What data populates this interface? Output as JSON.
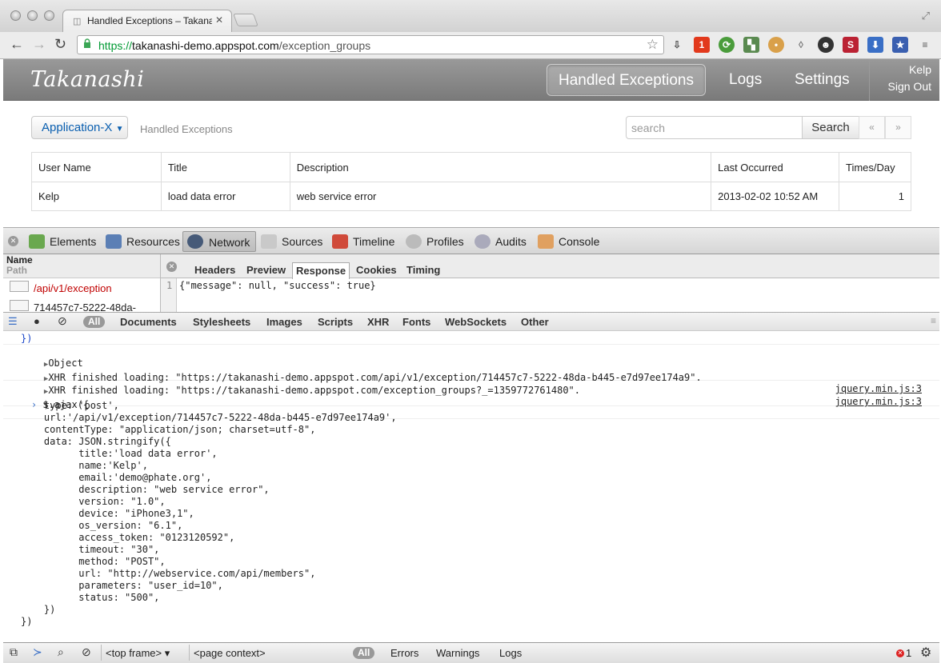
{
  "browser": {
    "tab_title": "Handled Exceptions – Takanashi",
    "url_protocol": "https://",
    "url_host": "takanashi-demo.appspot.com",
    "url_path": "/exception_groups",
    "extension_badge": "1"
  },
  "navbar": {
    "brand": "Takanashi",
    "items": [
      "Handled Exceptions",
      "Logs",
      "Settings"
    ],
    "user_name": "Kelp",
    "sign_out": "Sign Out"
  },
  "content": {
    "app_selector": "Application-X",
    "breadcrumb": "Handled Exceptions",
    "search_placeholder": "search",
    "search_button": "Search",
    "prev_page": "«",
    "next_page": "»",
    "table": {
      "headers": [
        "User Name",
        "Title",
        "Description",
        "Last Occurred",
        "Times/Day"
      ],
      "rows": [
        [
          "Kelp",
          "load data error",
          "web service error",
          "2013-02-02 10:52 AM",
          "1"
        ]
      ]
    }
  },
  "devtools": {
    "tabs": [
      "Elements",
      "Resources",
      "Network",
      "Sources",
      "Timeline",
      "Profiles",
      "Audits",
      "Console"
    ],
    "active_tab": "Network",
    "network": {
      "col_name": "Name",
      "col_path": "Path",
      "requests": [
        "/api/v1/exception",
        "714457c7-5222-48da-"
      ],
      "detail_tabs": [
        "Headers",
        "Preview",
        "Response",
        "Cookies",
        "Timing"
      ],
      "active_detail_tab": "Response",
      "response_line_no": "1",
      "response_body": "{\"message\": null, \"success\": true}"
    },
    "filters": [
      "All",
      "Documents",
      "Stylesheets",
      "Images",
      "Scripts",
      "XHR",
      "Fonts",
      "WebSockets",
      "Other"
    ],
    "console": {
      "lines": [
        "})",
        "Object",
        "XHR finished loading: \"https://takanashi-demo.appspot.com/api/v1/exception/714457c7-5222-48da-b445-e7d97ee174a9\".",
        "XHR finished loading: \"https://takanashi-demo.appspot.com/exception_groups?_=1359772761480\".",
        "$.ajax({",
        "    type: 'post',",
        "    url:'/api/v1/exception/714457c7-5222-48da-b445-e7d97ee174a9',",
        "    contentType: \"application/json; charset=utf-8\",",
        "    data: JSON.stringify({",
        "          title:'load data error',",
        "          name:'Kelp',",
        "          email:'demo@phate.org',",
        "          description: \"web service error\",",
        "          version: \"1.0\",",
        "          device: \"iPhone3,1\",",
        "          os_version: \"6.1\",",
        "          access_token: \"0123120592\",",
        "          timeout: \"30\",",
        "          method: \"POST\",",
        "          url: \"http://webservice.com/api/members\",",
        "          parameters: \"user_id=10\",",
        "          status: \"500\",",
        "    })",
        "})"
      ],
      "source_link": "jquery.min.js:3"
    },
    "bottom": {
      "frame": "<top frame>",
      "context": "<page context>",
      "levels": [
        "All",
        "Errors",
        "Warnings",
        "Logs"
      ],
      "error_count": "1"
    }
  },
  "colors": {
    "navbar": "#8a8a8a",
    "link_blue": "#0a5fb0",
    "url_green": "#009a33",
    "request_red": "#c00000",
    "console_blue": "#1a46c9"
  }
}
